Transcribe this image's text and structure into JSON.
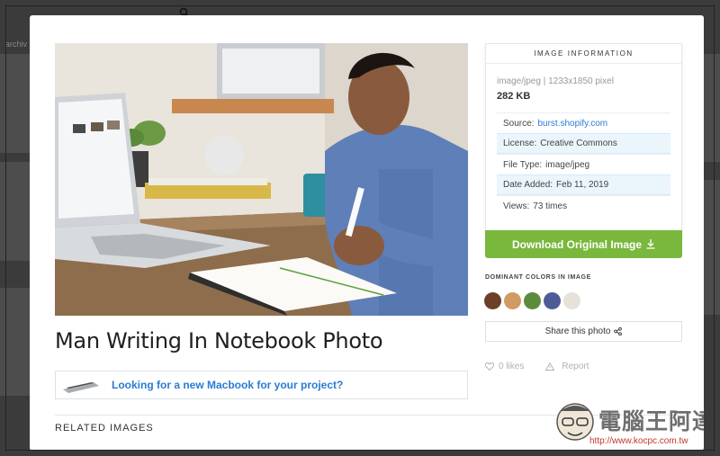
{
  "background": {
    "left_text": "archiv"
  },
  "photo": {
    "title": "Man Writing In Notebook Photo"
  },
  "ad": {
    "link_text": "Looking for a new Macbook for your project?"
  },
  "related": {
    "heading": "RELATED IMAGES"
  },
  "info": {
    "header": "IMAGE INFORMATION",
    "mime_dims": "image/jpeg | 1233x1850 pixel",
    "file_size": "282 KB",
    "rows": [
      {
        "key": "Source:",
        "value": "burst.shopify.com",
        "link": true
      },
      {
        "key": "License:",
        "value": "Creative Commons",
        "link": false
      },
      {
        "key": "File Type:",
        "value": "image/jpeg",
        "link": false
      },
      {
        "key": "Date Added:",
        "value": "Feb 11, 2019",
        "link": false
      },
      {
        "key": "Views:",
        "value": "73 times",
        "link": false
      }
    ]
  },
  "download": {
    "label": "Download Original Image",
    "color": "#79b83c"
  },
  "colors": {
    "label": "DOMINANT COLORS IN IMAGE",
    "swatches": [
      "#6b3f2a",
      "#d19a62",
      "#5e8a3d",
      "#4e5c96",
      "#e6e2da"
    ]
  },
  "share": {
    "label": "Share this photo"
  },
  "social": {
    "likes": "0 likes",
    "report": "Report"
  },
  "watermark": {
    "brand": "電腦王阿達",
    "url": "http://www.kocpc.com.tw"
  }
}
